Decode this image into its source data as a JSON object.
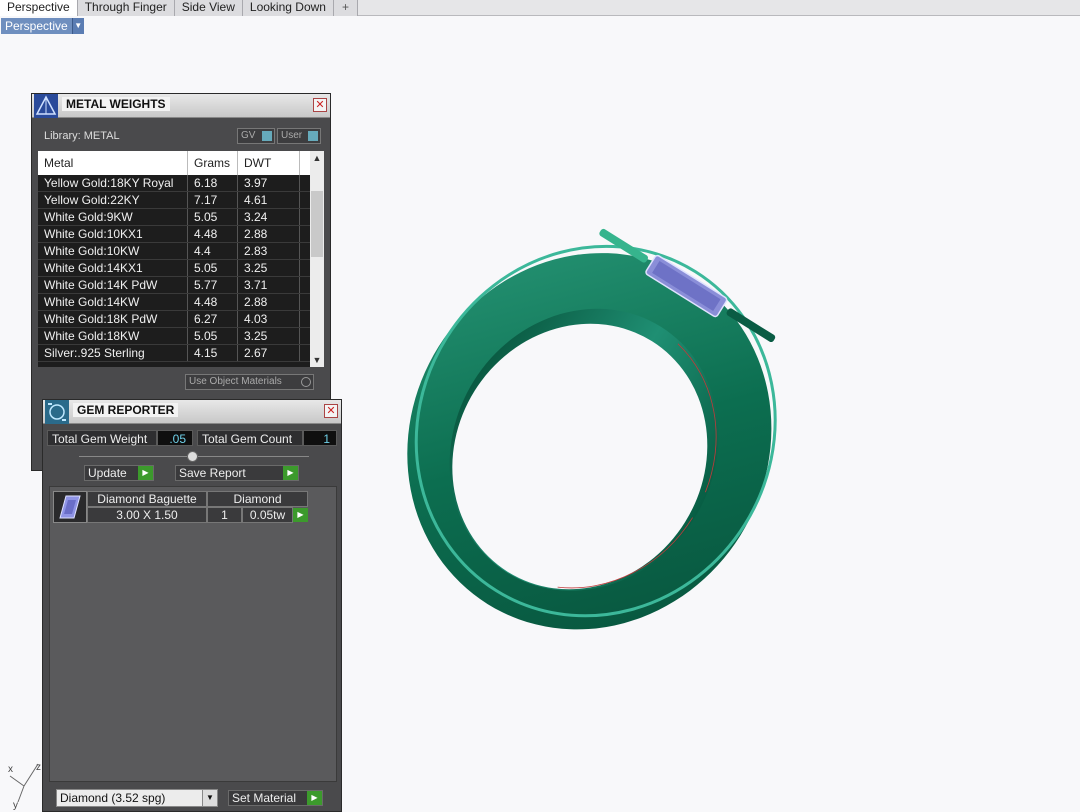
{
  "tabs": [
    "Perspective",
    "Through Finger",
    "Side View",
    "Looking Down"
  ],
  "tab_add": "+",
  "viewport_label": "Perspective",
  "metal_weights": {
    "title": "METAL WEIGHTS",
    "library": "Library: METAL",
    "toggle_gv": "GV",
    "toggle_user": "User",
    "columns": [
      "Metal",
      "Grams",
      "DWT"
    ],
    "rows": [
      [
        "Yellow Gold:18KY Royal",
        "6.18",
        "3.97"
      ],
      [
        "Yellow Gold:22KY",
        "7.17",
        "4.61"
      ],
      [
        "White Gold:9KW",
        "5.05",
        "3.24"
      ],
      [
        "White Gold:10KX1",
        "4.48",
        "2.88"
      ],
      [
        "White Gold:10KW",
        "4.4",
        "2.83"
      ],
      [
        "White Gold:14KX1",
        "5.05",
        "3.25"
      ],
      [
        "White Gold:14K PdW",
        "5.77",
        "3.71"
      ],
      [
        "White Gold:14KW",
        "4.48",
        "2.88"
      ],
      [
        "White Gold:18K PdW",
        "6.27",
        "4.03"
      ],
      [
        "White Gold:18KW",
        "5.05",
        "3.25"
      ],
      [
        "Silver:.925 Sterling",
        "4.15",
        "2.67"
      ]
    ],
    "use_object_materials": "Use Object Materials"
  },
  "gem_reporter": {
    "title": "GEM REPORTER",
    "total_weight_label": "Total Gem Weight",
    "total_weight_value": ".05",
    "total_count_label": "Total Gem Count",
    "total_count_value": "1",
    "update_label": "Update",
    "save_report_label": "Save Report",
    "gem": {
      "shape": "Diamond Baguette",
      "material": "Diamond",
      "size": "3.00 X 1.50",
      "count": "1",
      "weight": "0.05tw"
    },
    "material_select": "Diamond     (3.52 spg)",
    "set_material_label": "Set Material"
  },
  "axis_labels": {
    "x": "x",
    "y": "y",
    "z": "z"
  },
  "colors": {
    "ring": "#0f7a5a",
    "accent": "#3c9a2c",
    "viewport_bg": "#f8f8fa"
  }
}
